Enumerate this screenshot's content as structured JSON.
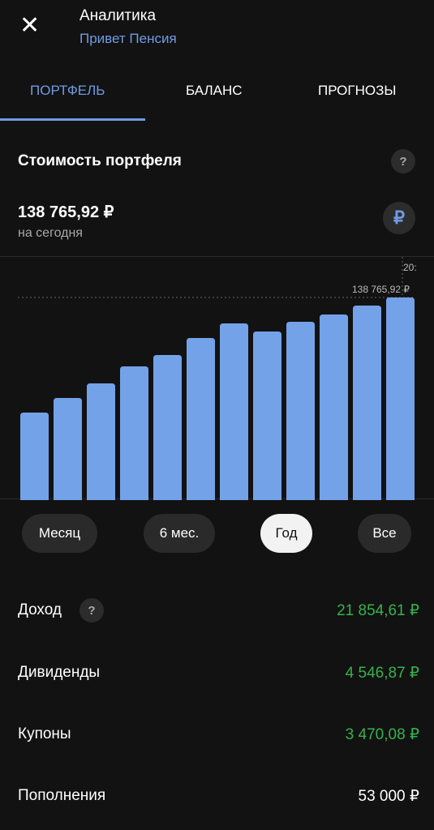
{
  "header": {
    "title": "Аналитика",
    "subtitle": "Привет Пенсия",
    "close_icon": "close-icon"
  },
  "tabs": [
    {
      "label": "Портфель",
      "active": true
    },
    {
      "label": "Баланс"
    },
    {
      "label": "Прогнозы"
    }
  ],
  "portfolio": {
    "title": "Стоимость портфеля",
    "help": "?",
    "value": "138 765,92 ₽",
    "caption": "на сегодня",
    "currency_symbol": "₽"
  },
  "colors": {
    "accent": "#6f9be3",
    "positive": "#35b24e",
    "bar": "#73a2e8"
  },
  "chart_data": {
    "type": "bar",
    "values": [
      59950,
      69940,
      79930,
      91590,
      99360,
      111010,
      121000,
      115460,
      122110,
      127110,
      133220,
      138765.92
    ],
    "ylim": [
      0,
      138765.92
    ],
    "annotation": "138 765,92 ₽",
    "cursor_label": "20:",
    "grid": false
  },
  "periods": [
    {
      "label": "Месяц"
    },
    {
      "label": "6 мес."
    },
    {
      "label": "Год",
      "selected": true
    },
    {
      "label": "Все"
    }
  ],
  "stats": [
    {
      "label": "Доход",
      "value": "21 854,61 ₽",
      "positive": true,
      "help": "?"
    },
    {
      "label": "Дивиденды",
      "value": "4 546,87 ₽",
      "positive": true
    },
    {
      "label": "Купоны",
      "value": "3 470,08 ₽",
      "positive": true
    },
    {
      "label": "Пополнения",
      "value": "53 000 ₽",
      "positive": false
    }
  ]
}
